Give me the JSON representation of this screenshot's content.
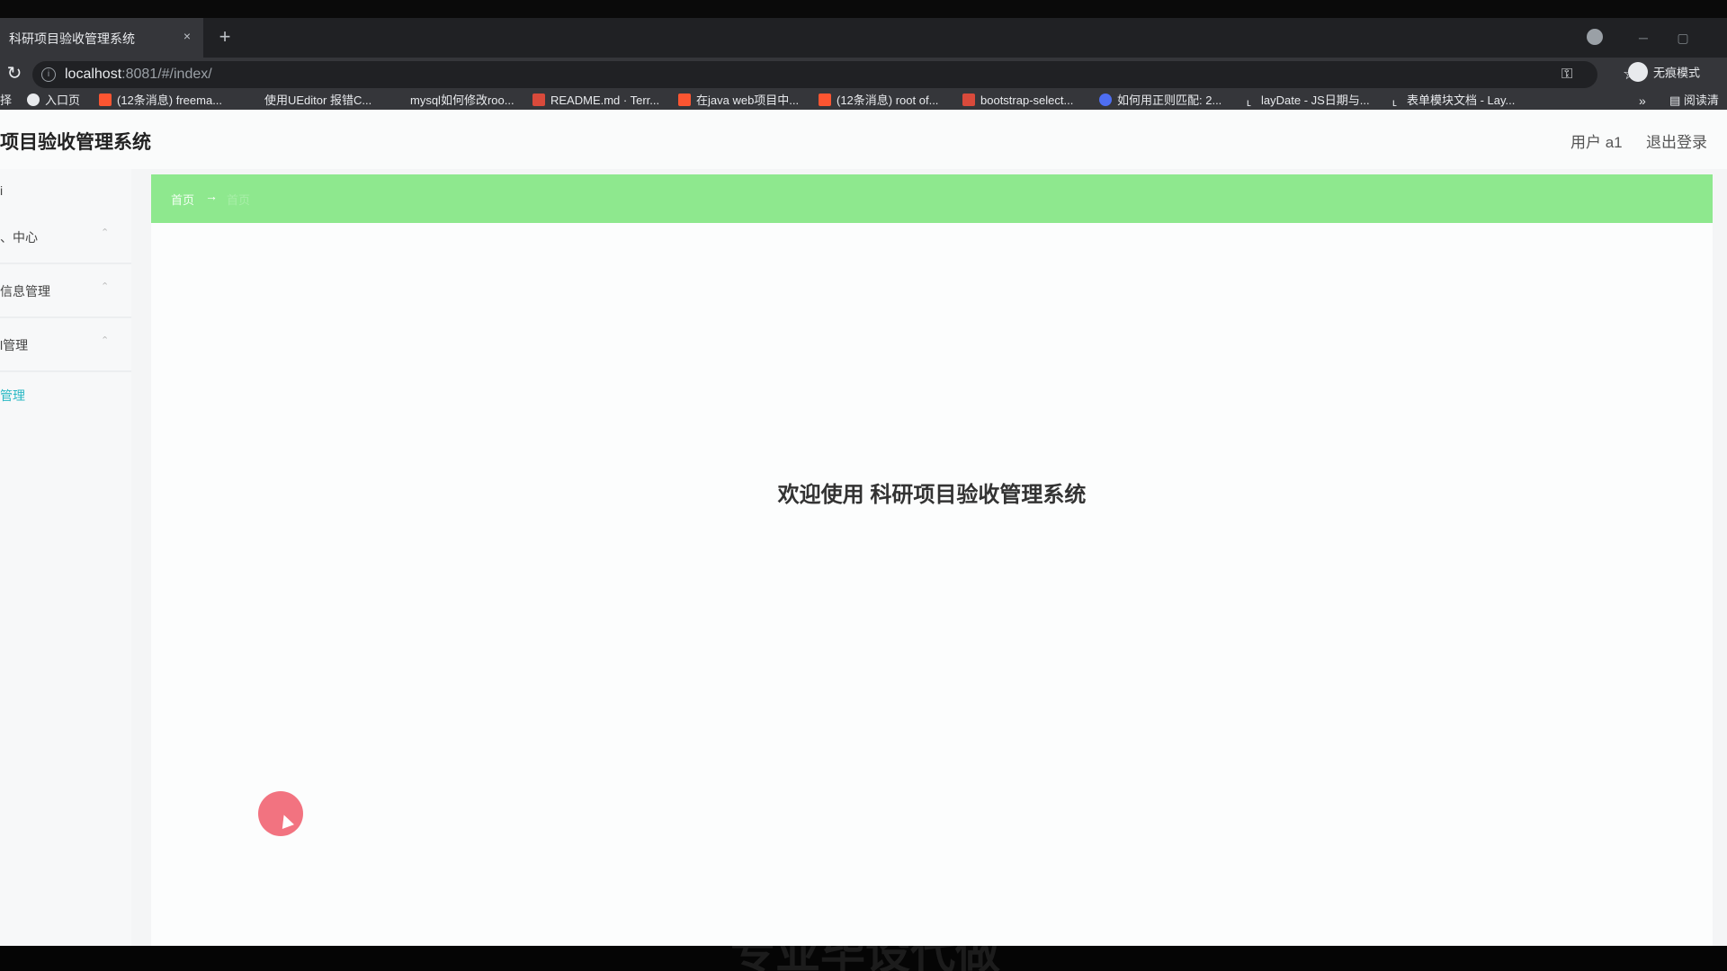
{
  "browser": {
    "tab_title": "科研项目验收管理系统",
    "tab_close": "×",
    "new_tab": "+",
    "url_host": "localhost",
    "url_rest": ":8081/#/index/",
    "incognito_label": "无痕模式",
    "bookmarks": [
      {
        "label": "入口页",
        "icon": "globe-icon"
      },
      {
        "label": "(12条消息) freema...",
        "icon": "csdn-icon"
      },
      {
        "label": "使用UEditor 报错C...",
        "icon": ""
      },
      {
        "label": "mysql如何修改roo...",
        "icon": ""
      },
      {
        "label": "README.md · Terr...",
        "icon": "gitee-icon"
      },
      {
        "label": "在java web项目中...",
        "icon": "csdn-icon"
      },
      {
        "label": "(12条消息) root of...",
        "icon": "csdn-icon"
      },
      {
        "label": "bootstrap-select...",
        "icon": "m-icon"
      },
      {
        "label": "如何用正则匹配: 2...",
        "icon": "baidu-icon"
      },
      {
        "label": "layDate - JS日期与...",
        "icon": "layui-icon"
      },
      {
        "label": "表单模块文档 - Lay...",
        "icon": "layui-icon"
      }
    ],
    "bookmarks_prefix": "择",
    "bookmarks_more": "»",
    "reading_list": "阅读清"
  },
  "header": {
    "title": "项目验收管理系统",
    "user": "用户 a1",
    "logout": "退出登录"
  },
  "sidebar": {
    "items": [
      {
        "label": "i",
        "chevron": ""
      },
      {
        "label": "、中心",
        "chevron": "⌃"
      },
      {
        "label": "信息管理",
        "chevron": "⌃"
      },
      {
        "label": "l管理",
        "chevron": "⌃"
      },
      {
        "label": "管理",
        "chevron": ""
      }
    ]
  },
  "main": {
    "breadcrumb_home": "首页",
    "breadcrumb_arrow": "→",
    "breadcrumb_current": "首页",
    "welcome": "欢迎使用 科研项目验收管理系统"
  },
  "overlay": {
    "watermark": "专业毕设代做"
  },
  "colors": {
    "breadcrumb_bg": "#8ee88e",
    "active_menu": "#2ab8c4",
    "cursor_highlight": "#f0606e"
  }
}
